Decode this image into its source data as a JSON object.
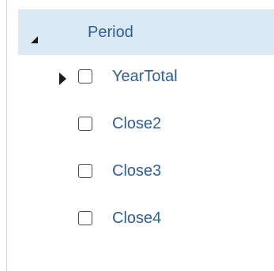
{
  "tree": {
    "root": {
      "label": "Period",
      "expanded": true
    },
    "items": [
      {
        "label": "YearTotal",
        "checked": false,
        "has_children": true,
        "expanded": false
      },
      {
        "label": "Close2",
        "checked": false,
        "has_children": false
      },
      {
        "label": "Close3",
        "checked": false,
        "has_children": false
      },
      {
        "label": "Close4",
        "checked": false,
        "has_children": false
      }
    ]
  },
  "colors": {
    "selection_background": "#dbe9f4",
    "label_text": "#2f5f94",
    "toggle_glyph": "#1a1a1a",
    "checkbox_border": "#4a4a4a"
  },
  "icons": {
    "root_toggle": "collapse-triangle-icon",
    "child_expander": "expand-triangle-icon",
    "checkbox": "checkbox-icon"
  }
}
